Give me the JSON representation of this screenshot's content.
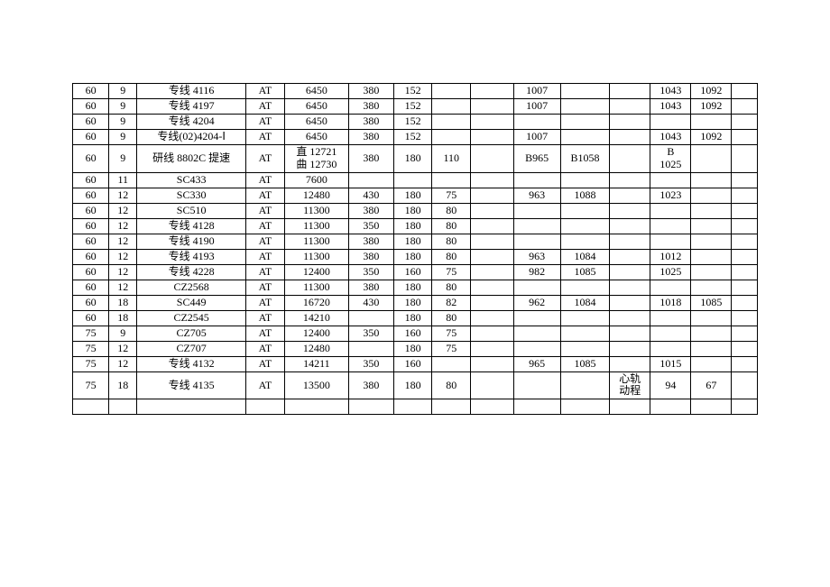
{
  "rows": [
    [
      "60",
      "9",
      "专线 4116",
      "AT",
      "6450",
      "380",
      "152",
      "",
      "",
      "1007",
      "",
      "",
      "1043",
      "1092",
      ""
    ],
    [
      "60",
      "9",
      "专线 4197",
      "AT",
      "6450",
      "380",
      "152",
      "",
      "",
      "1007",
      "",
      "",
      "1043",
      "1092",
      ""
    ],
    [
      "60",
      "9",
      "专线 4204",
      "AT",
      "6450",
      "380",
      "152",
      "",
      "",
      "",
      "",
      "",
      "",
      "",
      ""
    ],
    [
      "60",
      "9",
      "专线(02)4204-Ⅰ",
      "AT",
      "6450",
      "380",
      "152",
      "",
      "",
      "1007",
      "",
      "",
      "1043",
      "1092",
      ""
    ],
    [
      "60",
      "9",
      "研线 8802C 提速",
      "AT",
      "直 12721\n曲 12730",
      "380",
      "180",
      "110",
      "",
      "B965",
      "B1058",
      "",
      "B\n1025",
      "",
      ""
    ],
    [
      "60",
      "11",
      "SC433",
      "AT",
      "7600",
      "",
      "",
      "",
      "",
      "",
      "",
      "",
      "",
      "",
      ""
    ],
    [
      "60",
      "12",
      "SC330",
      "AT",
      "12480",
      "430",
      "180",
      "75",
      "",
      "963",
      "1088",
      "",
      "1023",
      "",
      ""
    ],
    [
      "60",
      "12",
      "SC510",
      "AT",
      "11300",
      "380",
      "180",
      "80",
      "",
      "",
      "",
      "",
      "",
      "",
      ""
    ],
    [
      "60",
      "12",
      "专线 4128",
      "AT",
      "11300",
      "350",
      "180",
      "80",
      "",
      "",
      "",
      "",
      "",
      "",
      ""
    ],
    [
      "60",
      "12",
      "专线 4190",
      "AT",
      "11300",
      "380",
      "180",
      "80",
      "",
      "",
      "",
      "",
      "",
      "",
      ""
    ],
    [
      "60",
      "12",
      "专线 4193",
      "AT",
      "11300",
      "380",
      "180",
      "80",
      "",
      "963",
      "1084",
      "",
      "1012",
      "",
      ""
    ],
    [
      "60",
      "12",
      "专线 4228",
      "AT",
      "12400",
      "350",
      "160",
      "75",
      "",
      "982",
      "1085",
      "",
      "1025",
      "",
      ""
    ],
    [
      "60",
      "12",
      "CZ2568",
      "AT",
      "11300",
      "380",
      "180",
      "80",
      "",
      "",
      "",
      "",
      "",
      "",
      ""
    ],
    [
      "60",
      "18",
      "SC449",
      "AT",
      "16720",
      "430",
      "180",
      "82",
      "",
      "962",
      "1084",
      "",
      "1018",
      "1085",
      ""
    ],
    [
      "60",
      "18",
      "CZ2545",
      "AT",
      "14210",
      "",
      "180",
      "80",
      "",
      "",
      "",
      "",
      "",
      "",
      ""
    ],
    [
      "75",
      "9",
      "CZ705",
      "AT",
      "12400",
      "350",
      "160",
      "75",
      "",
      "",
      "",
      "",
      "",
      "",
      ""
    ],
    [
      "75",
      "12",
      "CZ707",
      "AT",
      "12480",
      "",
      "180",
      "75",
      "",
      "",
      "",
      "",
      "",
      "",
      ""
    ],
    [
      "75",
      "12",
      "专线 4132",
      "AT",
      "14211",
      "350",
      "160",
      "",
      "",
      "965",
      "1085",
      "",
      "1015",
      "",
      ""
    ],
    [
      "75",
      "18",
      "专线 4135",
      "AT",
      "13500",
      "380",
      "180",
      "80",
      "",
      "",
      "",
      "心轨\n动程",
      "94",
      "67",
      ""
    ],
    [
      "",
      "",
      "",
      "",
      "",
      "",
      "",
      "",
      "",
      "",
      "",
      "",
      "",
      "",
      ""
    ]
  ]
}
